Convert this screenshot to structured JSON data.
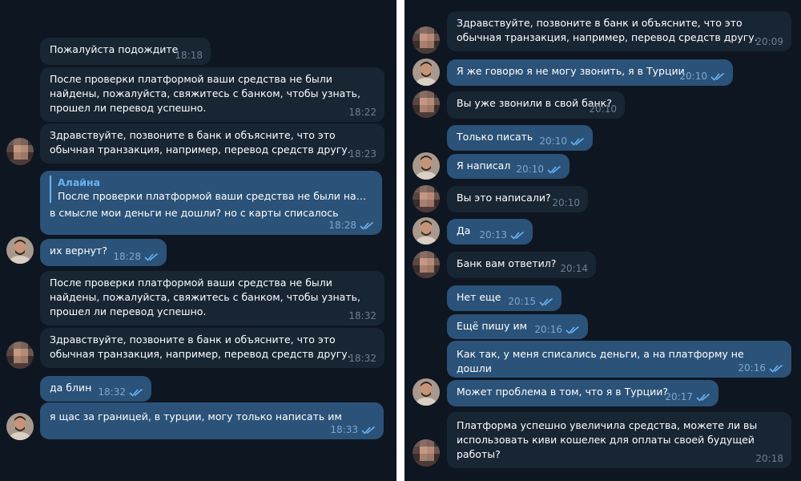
{
  "left": {
    "messages": [
      {
        "text": "Пожалуйста подождите",
        "time": "18:18"
      },
      {
        "text": "После проверки платформой ваши средства не были найдены, пожалуйста, свяжитесь с банком, чтобы узнать, прошел ли перевод успешно.",
        "time": "18:22"
      },
      {
        "text": "Здравствуйте, позвоните в банк и объясните, что это обычная транзакция, например, перевод средств другу.",
        "time": "18:23"
      },
      {
        "reply_name": "Алайна",
        "reply_text": "После проверки платформой ваши средства не были найден...",
        "text": "в смысле мои деньги не дошли? но с карты списалось",
        "time": "18:28"
      },
      {
        "text": "их вернут?",
        "time": "18:28"
      },
      {
        "text": "После проверки платформой ваши средства не были найдены, пожалуйста, свяжитесь с банком, чтобы узнать, прошел ли перевод успешно.",
        "time": "18:32"
      },
      {
        "text": "Здравствуйте, позвоните в банк и объясните, что это обычная транзакция, например, перевод средств другу.",
        "time": "18:32"
      },
      {
        "text": "да блин",
        "time": "18:32"
      },
      {
        "text": "я щас за границей, в турции, могу только написать им",
        "time": "18:33"
      }
    ]
  },
  "right": {
    "messages": [
      {
        "text": "Здравствуйте, позвоните в банк и объясните, что это обычная транзакция, например, перевод средств другу.",
        "time": "20:09"
      },
      {
        "text": "Я же говорю я не могу звонить, я в Турции",
        "time": "20:10"
      },
      {
        "text": "Вы уже звонили в свой банк?",
        "time": "20:10"
      },
      {
        "text": "Только писать",
        "time": "20:10"
      },
      {
        "text": "Я написал",
        "time": "20:10"
      },
      {
        "text": "Вы это написали?",
        "time": "20:10"
      },
      {
        "text": "Да",
        "time": "20:13"
      },
      {
        "text": "Банк вам ответил?",
        "time": "20:14"
      },
      {
        "text": "Нет еще",
        "time": "20:15"
      },
      {
        "text": "Ещё пишу им",
        "time": "20:16"
      },
      {
        "text": "Как так, у меня списались деньги, а на платформу не дошли",
        "time": "20:16"
      },
      {
        "text": "Может проблема в том, что я в Турции?",
        "time": "20:17"
      },
      {
        "text": "Платформа успешно увеличила средства, можете ли вы использовать киви кошелек для оплаты своей будущей работы?",
        "time": "20:18"
      }
    ]
  },
  "colors": {
    "chat_background": "#0e1621",
    "incoming_bubble": "#182533",
    "outgoing_bubble": "#2b5278",
    "reply_accent": "#6ab3f3",
    "read_check": "#6ab3f3"
  },
  "icons": {
    "read_receipt": "double-check-icon",
    "avatar_agent": "blurred-avatar",
    "avatar_user": "user-photo-avatar"
  }
}
